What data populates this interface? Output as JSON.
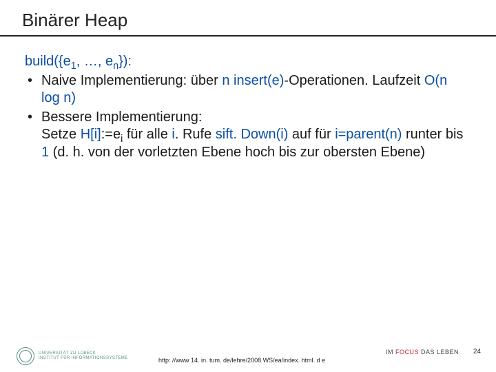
{
  "title": "Binärer Heap",
  "proc": {
    "name": "build",
    "arg_open": "({e",
    "sub1": "1",
    "mid": ", …, e",
    "subn": "n",
    "close": "}):"
  },
  "bullets": [
    {
      "pre": "Naive Implementierung: über ",
      "n1": "n",
      "mid1": " ",
      "insert": "insert(e)",
      "post1": "-Operationen. Laufzeit ",
      "bigO": "O(n log n)"
    },
    {
      "line1_a": "Bessere Implementierung:",
      "line2_a": "Setze ",
      "H": "H[i]",
      "assign": ":=e",
      "sub_i": "i",
      "line2_b": " für alle ",
      "i1": "i",
      "line2_c": ". Rufe ",
      "sift": "sift. Down(i)",
      "line2_d": " auf für ",
      "ip": "i=parent(n)",
      "line3_a": " runter bis ",
      "one": "1",
      "line3_b": " (d. h. von der vorletzten Ebene hoch bis zur obersten Ebene)"
    }
  ],
  "footer": {
    "uni_line1": "UNIVERSITÄT ZU LÜBECK",
    "uni_line2": "INSTITUT FÜR INFORMATIONSSYSTEME",
    "src": "http: //www 14. in. tum. de/lehre/2008 WS/ea/index. html. d e",
    "motto_pre": "IM ",
    "motto_red": "FOCUS",
    "motto_post": " DAS LEBEN",
    "page": "24"
  }
}
